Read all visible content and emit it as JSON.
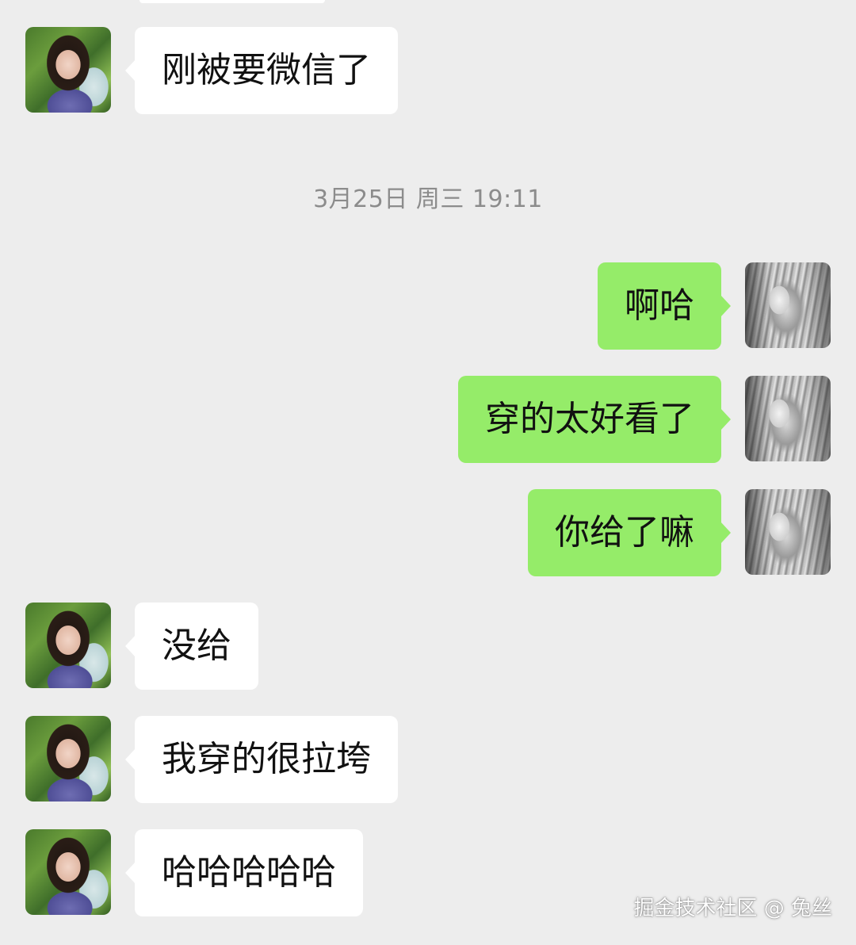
{
  "chat": {
    "timestamp": "3月25日 周三 19:11",
    "messages": [
      {
        "side": "incoming",
        "text": "刚被要微信了"
      },
      {
        "side": "outgoing",
        "text": "啊哈"
      },
      {
        "side": "outgoing",
        "text": "穿的太好看了"
      },
      {
        "side": "outgoing",
        "text": "你给了嘛"
      },
      {
        "side": "incoming",
        "text": "没给"
      },
      {
        "side": "incoming",
        "text": "我穿的很拉垮"
      },
      {
        "side": "incoming",
        "text": "哈哈哈哈哈"
      }
    ]
  },
  "watermark": "掘金技术社区 @ 兔丝",
  "colors": {
    "background": "#ededed",
    "incoming_bubble": "#ffffff",
    "outgoing_bubble": "#95ec69",
    "timestamp_text": "#8c8c8c"
  },
  "icons": {
    "incoming_avatar": "contact-photo-avatar",
    "outgoing_avatar": "anime-illustration-avatar"
  }
}
